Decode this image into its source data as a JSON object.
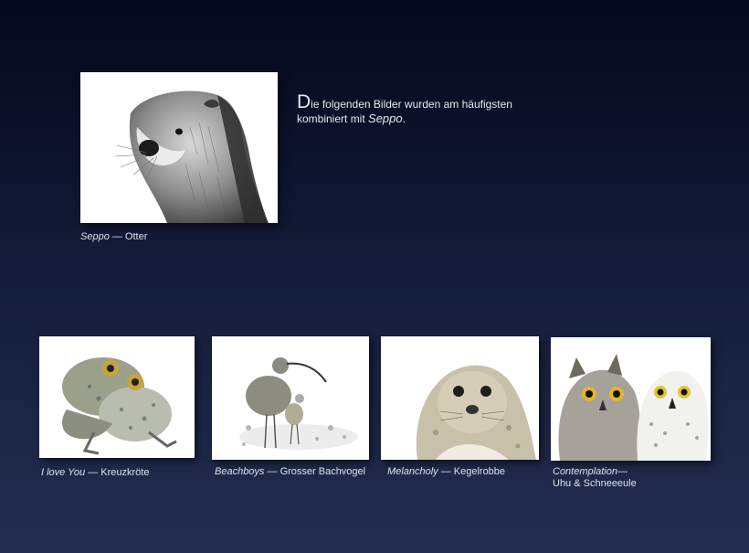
{
  "featured": {
    "title": "Seppo",
    "subject": "Otter"
  },
  "intro": {
    "initial": "D",
    "text_line1": "ie folgenden Bilder wurden am häufigsten",
    "text_line2": "kombiniert  mit ",
    "name": "Seppo",
    "suffix": "."
  },
  "gallery": [
    {
      "title": "I love You",
      "subject": "Kreuzkröte"
    },
    {
      "title": "Beachboys",
      "subject": "Grosser Bachvogel"
    },
    {
      "title": "Melancholy",
      "subject": "Kegelrobbe"
    },
    {
      "title": "Contemplation",
      "subject": "Uhu & Schneeeule"
    }
  ],
  "separator": " — ",
  "separator_tight": "—"
}
